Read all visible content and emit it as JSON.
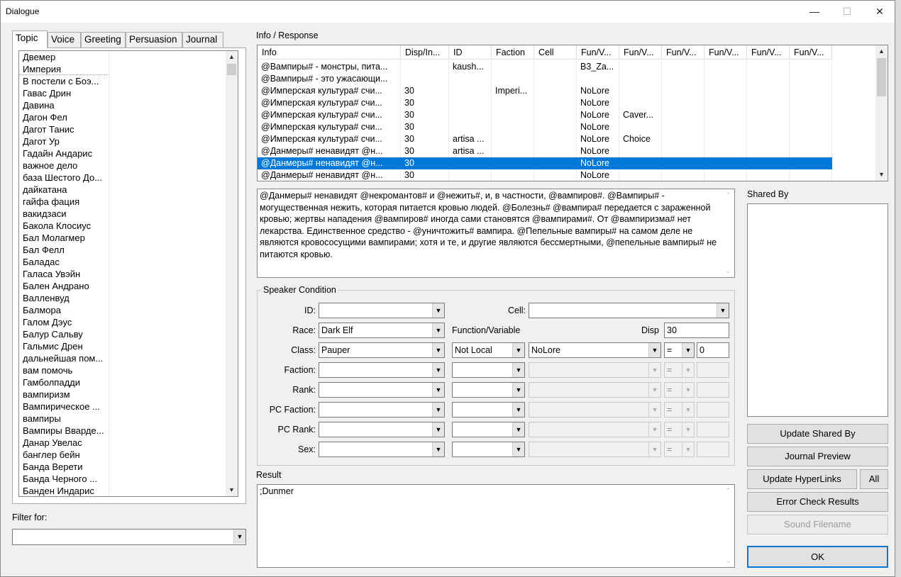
{
  "window": {
    "title": "Dialogue",
    "minimize": "—",
    "maximize": "☐",
    "close": "✕"
  },
  "tabs": [
    "Topic",
    "Voice",
    "Greeting",
    "Persuasion",
    "Journal"
  ],
  "topics": [
    "Двемер",
    "Империя",
    "В постели с Боэ...",
    "Гавас Дрин",
    "Давина",
    "Дагон Фел",
    "Дагот Танис",
    "Дагот Ур",
    "Гадайн Андарис",
    "важное дело",
    "база Шестого До...",
    "дайкатана",
    "гайфа фация",
    "вакидзаси",
    "Бакола Клосиус",
    "Бал Молагмер",
    "Бал Фелл",
    "Баладас",
    "Галаса Увэйн",
    "Бален Андрано",
    "Валленвуд",
    "Балмора",
    "Галом Дэус",
    "Балур Сальву",
    "Гальмис Дрен",
    "дальнейшая пом...",
    "вам помочь",
    "Гамболпадди",
    "вампиризм",
    "Вампирическое ...",
    "вампиры",
    "Вампиры Вварде...",
    "Данар Увелас",
    "банглер бейн",
    "Банда Верети",
    "Банда Черного ...",
    "Банден Индарис"
  ],
  "filter": {
    "label": "Filter for:",
    "value": ""
  },
  "info": {
    "label": "Info / Response",
    "columns": [
      "Info",
      "Disp/In...",
      "ID",
      "Faction",
      "Cell",
      "Fun/V...",
      "Fun/V...",
      "Fun/V...",
      "Fun/V...",
      "Fun/V...",
      "Fun/V..."
    ],
    "rows": [
      [
        "@Вампиры# - монстры, пита...",
        "",
        "kaush...",
        "",
        "",
        "B3_Za...",
        "",
        "",
        "",
        "",
        ""
      ],
      [
        "@Вампиры# - это ужасающи...",
        "",
        "",
        "",
        "",
        "",
        "",
        "",
        "",
        "",
        ""
      ],
      [
        "@Имперская культура# счи...",
        "30",
        "",
        "Imperi...",
        "",
        "NoLore",
        "",
        "",
        "",
        "",
        ""
      ],
      [
        "@Имперская культура# счи...",
        "30",
        "",
        "",
        "",
        "NoLore",
        "",
        "",
        "",
        "",
        ""
      ],
      [
        "@Имперская культура# счи...",
        "30",
        "",
        "",
        "",
        "NoLore",
        "Caver...",
        "",
        "",
        "",
        ""
      ],
      [
        "@Имперская культура# счи...",
        "30",
        "",
        "",
        "",
        "NoLore",
        "",
        "",
        "",
        "",
        ""
      ],
      [
        "@Имперская культура# счи...",
        "30",
        "artisa ...",
        "",
        "",
        "NoLore",
        "Choice",
        "",
        "",
        "",
        ""
      ],
      [
        "@Данмеры# ненавидят @н...",
        "30",
        "artisa ...",
        "",
        "",
        "NoLore",
        "",
        "",
        "",
        "",
        ""
      ],
      [
        "@Данмеры# ненавидят @н...",
        "30",
        "",
        "",
        "",
        "NoLore",
        "",
        "",
        "",
        "",
        ""
      ],
      [
        "@Данмеры# ненавидят @н...",
        "30",
        "",
        "",
        "",
        "NoLore",
        "",
        "",
        "",
        "",
        ""
      ]
    ],
    "selected_row": 8
  },
  "response_text": "@Данмеры# ненавидят @некромантов# и @нежить#, и, в частности, @вампиров#. @Вампиры# - могущественная нежить, которая питается кровью людей. @Болезнь# @вампира# передается с зараженной кровью; жертвы нападения @вампиров# иногда сами становятся @вампирами#. От @вампиризма# нет лекарства. Единственное средство - @уничтожить# вампира. @Пепельные вампиры# на самом деле не являются кровососущими вампирами; хотя и те, и другие являются бессмертными, @пепельные вампиры# не питаются кровью.",
  "speaker": {
    "legend": "Speaker Condition",
    "id_label": "ID:",
    "id_value": "",
    "cell_label": "Cell:",
    "cell_value": "",
    "race_label": "Race:",
    "race_value": "Dark Elf",
    "funcvar_label": "Function/Variable",
    "disp_label": "Disp",
    "disp_value": "30",
    "class_label": "Class:",
    "class_value": "Pauper",
    "func1_type": "Not Local",
    "func1_var": "NoLore",
    "func1_op": "=",
    "func1_value": "0",
    "faction_label": "Faction:",
    "rank_label": "Rank:",
    "pcfaction_label": "PC Faction:",
    "pcrank_label": "PC Rank:",
    "sex_label": "Sex:",
    "op_equals": "="
  },
  "result": {
    "label": "Result",
    "value": ";Dunmer"
  },
  "shared_by": {
    "label": "Shared By"
  },
  "buttons": {
    "update_shared": "Update Shared By",
    "journal_preview": "Journal Preview",
    "update_hyperlinks": "Update HyperLinks",
    "all": "All",
    "error_check": "Error Check Results",
    "sound_filename": "Sound Filename",
    "ok": "OK"
  },
  "icons": {
    "dropdown": "dropdown-arrow-icon",
    "scroll_up": "scroll-up-icon",
    "scroll_down": "scroll-down-icon"
  }
}
